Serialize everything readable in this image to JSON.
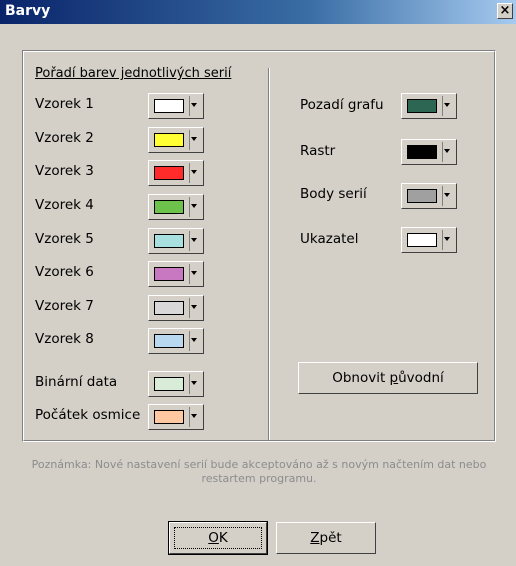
{
  "window": {
    "title": "Barvy",
    "close_glyph": "×"
  },
  "section_title": "Pořadí barev jednotlivých serií",
  "left_items": [
    {
      "label": "Vzorek 1",
      "color": "#ffffff"
    },
    {
      "label": "Vzorek 2",
      "color": "#ffff33"
    },
    {
      "label": "Vzorek 3",
      "color": "#ff2a2a"
    },
    {
      "label": "Vzorek 4",
      "color": "#6cc24a"
    },
    {
      "label": "Vzorek 5",
      "color": "#a8e0e0"
    },
    {
      "label": "Vzorek 6",
      "color": "#c878c0"
    },
    {
      "label": "Vzorek 7",
      "color": "#d8d8d8"
    },
    {
      "label": "Vzorek 8",
      "color": "#b8d8f0"
    },
    {
      "label": "Binární data",
      "color": "#d8ecd8"
    },
    {
      "label": "Počátek osmice",
      "color": "#ffc8a0"
    }
  ],
  "right_items": [
    {
      "label": "Pozadí grafu",
      "color": "#2e6654"
    },
    {
      "label": "Rastr",
      "color": "#000000"
    },
    {
      "label": "Body serií",
      "color": "#a0a0a0"
    },
    {
      "label": "Ukazatel",
      "color": "#ffffff"
    }
  ],
  "restore_button": {
    "pre": "Obnovit ",
    "underline": "p",
    "post": "ůvodní"
  },
  "note": "Poznámka: Nové nastavení serií bude akceptováno až s novým načtením dat nebo restartem programu.",
  "ok_button": {
    "underline": "O",
    "post": "K"
  },
  "back_button": {
    "underline": "Z",
    "post": "pět"
  }
}
